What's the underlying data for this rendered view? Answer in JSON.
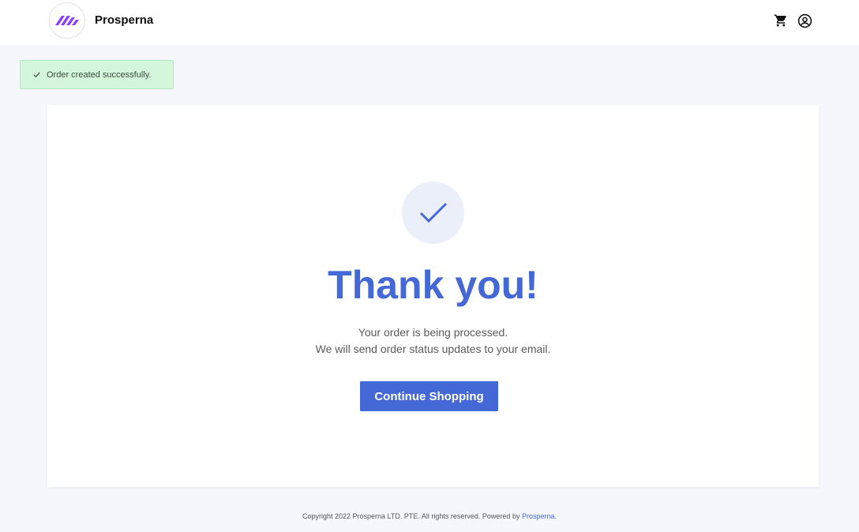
{
  "header": {
    "brand_name": "Prosperna",
    "icons": {
      "logo": "prosperna-logo",
      "cart": "cart-icon",
      "account": "account-icon"
    }
  },
  "toast": {
    "message": "Order created successfully.",
    "icon": "check-icon"
  },
  "confirmation": {
    "icon": "check-icon",
    "title": "Thank you!",
    "line1": "Your order is being processed.",
    "line2": "We will send order status updates to your email.",
    "button_label": "Continue Shopping"
  },
  "footer": {
    "copyright": "Copyright  2022 Prosperna LTD. PTE. All rights reserved. Powered by ",
    "link_text": "Prosperna",
    "suffix": "."
  },
  "colors": {
    "accent": "#4469d6",
    "logo_purple": "#8a3ffc",
    "toast_bg": "#d4f7dc",
    "page_bg": "#f6f7fd"
  }
}
